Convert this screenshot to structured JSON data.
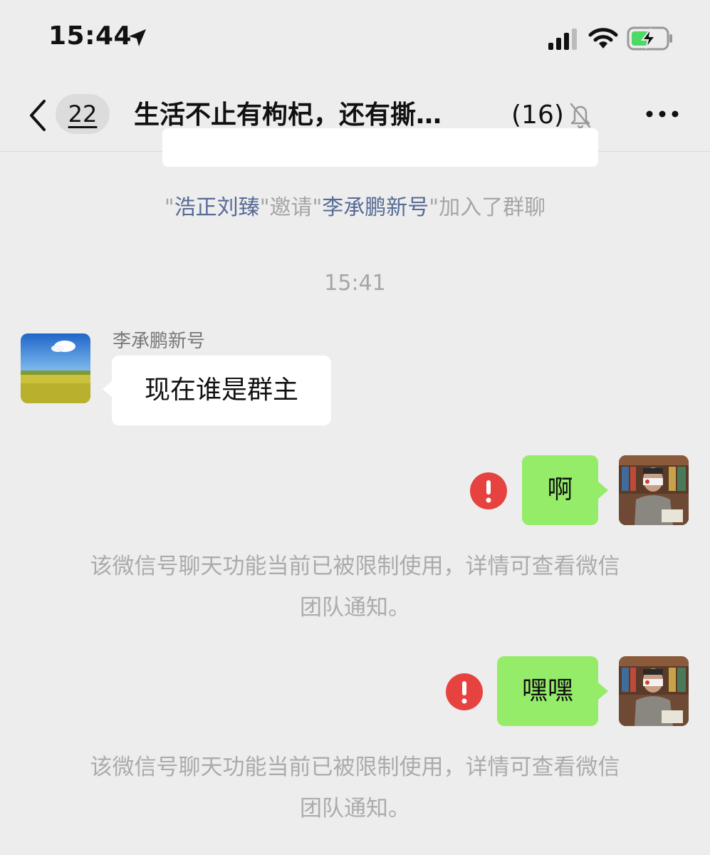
{
  "status_bar": {
    "time": "15:44",
    "icons": [
      "location-arrow-icon",
      "cellular-signal-icon",
      "wifi-icon",
      "battery-charging-icon"
    ]
  },
  "nav": {
    "unread_count": "22",
    "title": "生活不止有枸杞，还有撕…",
    "member_count": "(16)",
    "icons": [
      "back-chevron-icon",
      "mute-bell-icon",
      "more-dots-icon"
    ]
  },
  "system_join": {
    "q1": "\"",
    "inviter": "浩正刘臻",
    "q2": "\"邀请\"",
    "invitee": "李承鹏新号",
    "tail": "\"加入了群聊"
  },
  "timestamp": "15:41",
  "messages": [
    {
      "sender": "李承鹏新号",
      "text": "现在谁是群主",
      "direction": "incoming"
    },
    {
      "text": "啊",
      "direction": "outgoing",
      "status": "failed"
    },
    {
      "text": "嘿嘿",
      "direction": "outgoing",
      "status": "failed"
    }
  ],
  "notices": [
    {
      "line1": "该微信号聊天功能当前已被限制使用，详情可查看微信",
      "line2": "团队通知。"
    },
    {
      "line1": "该微信号聊天功能当前已被限制使用，详情可查看微信",
      "line2": "团队通知。"
    }
  ],
  "colors": {
    "background": "#ededed",
    "outgoing_bubble": "#95ec69",
    "incoming_bubble": "#ffffff",
    "link": "#576b95",
    "error": "#e64340",
    "battery": "#4cd964"
  }
}
